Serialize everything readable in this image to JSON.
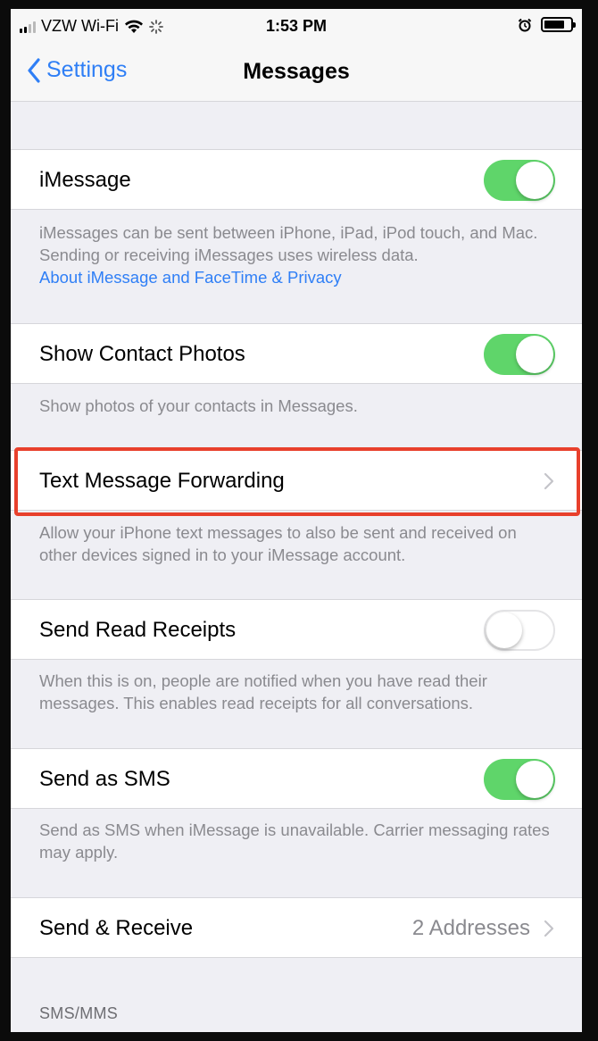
{
  "status_bar": {
    "carrier": "VZW Wi-Fi",
    "time": "1:53 PM",
    "icons": [
      "signal-icon",
      "wifi-icon",
      "loading-spinner-icon",
      "alarm-icon",
      "battery-icon"
    ]
  },
  "nav": {
    "back_label": "Settings",
    "title": "Messages"
  },
  "rows": {
    "imessage": {
      "label": "iMessage",
      "toggle_on": true
    },
    "show_contact_photos": {
      "label": "Show Contact Photos",
      "toggle_on": true
    },
    "text_message_forwarding": {
      "label": "Text Message Forwarding"
    },
    "send_read_receipts": {
      "label": "Send Read Receipts",
      "toggle_on": false
    },
    "send_as_sms": {
      "label": "Send as SMS",
      "toggle_on": true
    },
    "send_receive": {
      "label": "Send & Receive",
      "value": "2 Addresses"
    }
  },
  "footers": {
    "imessage": "iMessages can be sent between iPhone, iPad, iPod touch, and Mac. Sending or receiving iMessages uses wireless data.",
    "imessage_link": "About iMessage and FaceTime & Privacy",
    "show_contact_photos": "Show photos of your contacts in Messages.",
    "text_message_forwarding": "Allow your iPhone text messages to also be sent and received on other devices signed in to your iMessage account.",
    "send_read_receipts": "When this is on, people are notified when you have read their messages. This enables read receipts for all conversations.",
    "send_as_sms": "Send as SMS when iMessage is unavailable. Carrier messaging rates may apply."
  },
  "section_headers": {
    "sms_mms": "SMS/MMS"
  },
  "colors": {
    "accent": "#2f7ff6",
    "toggle_on": "#5fd56a",
    "highlight": "#e8402c",
    "background": "#efeff4"
  }
}
